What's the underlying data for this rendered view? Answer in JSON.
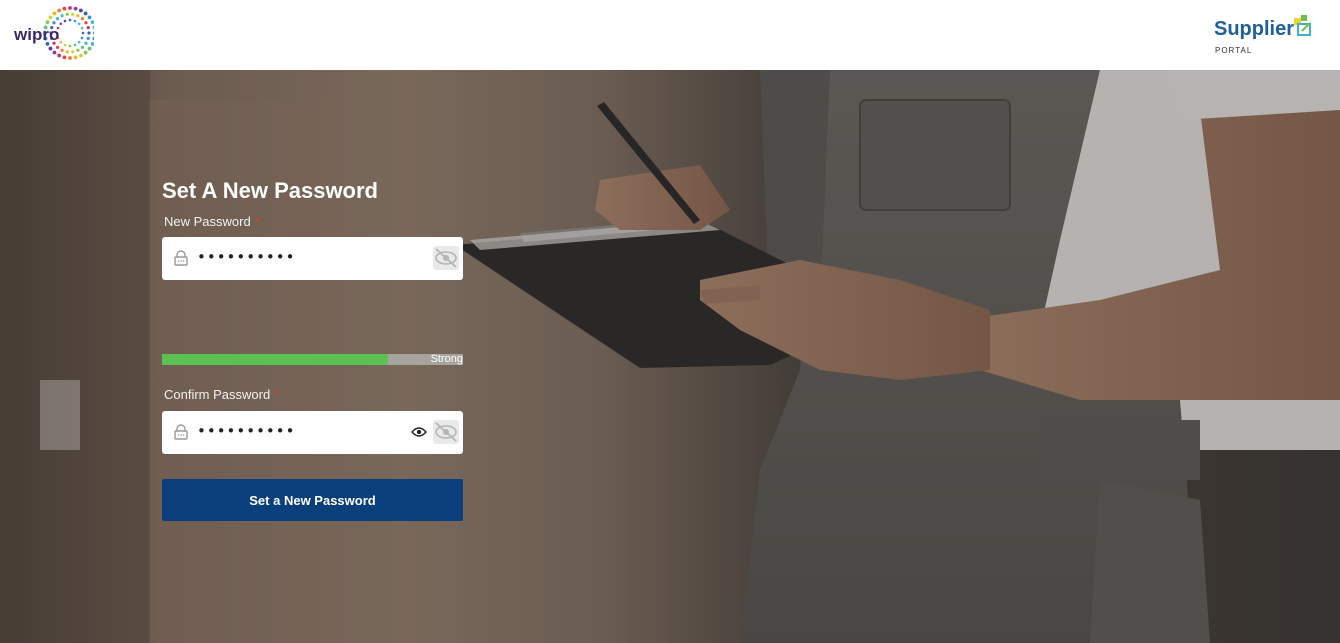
{
  "header": {
    "left_logo_text": "wipro",
    "right_logo_text": "Supplier",
    "right_logo_subtext": "PORTAL"
  },
  "form": {
    "title": "Set A New Password",
    "new_password": {
      "label": "New Password",
      "required_mark": "*",
      "masked_value": "••••••••••",
      "strength_label": "Strong",
      "strength_fraction": 0.75
    },
    "confirm_password": {
      "label": "Confirm Password",
      "required_mark": "*",
      "masked_value": "••••••••••"
    },
    "submit_label": "Set a New Password"
  },
  "colors": {
    "submit_bg": "#0b3f7c",
    "strength_fill": "#5cc152",
    "required": "#e03a3a"
  },
  "icons": [
    "lock-icon",
    "eye-off-icon",
    "eye-icon"
  ]
}
